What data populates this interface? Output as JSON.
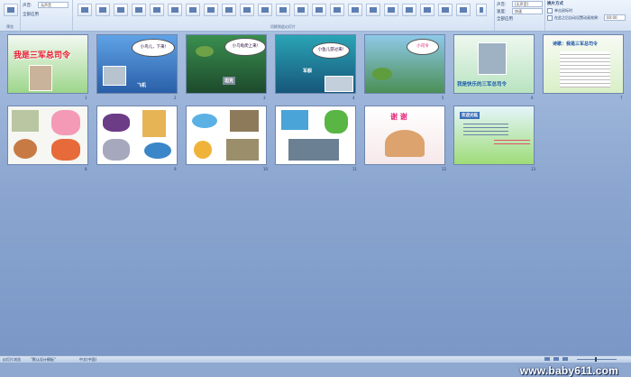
{
  "ribbon": {
    "left_group": {
      "btn_preview": "预览",
      "btn_apply": "应用",
      "label": "预览"
    },
    "sound_label": "声音:",
    "sound_value": "[无声音]",
    "speed_label": "速度:",
    "speed_value": "快速",
    "apply_all": "全部应用",
    "transition_group_label": "切换到此幻灯片",
    "advance_group_label": "换片方式",
    "on_click": "单击鼠标时",
    "auto_after": "在此之后自动设置动画效果:",
    "auto_time": "00:00",
    "field_sound": "无声音"
  },
  "slides": [
    {
      "num": "1",
      "title": "我是三军总司令"
    },
    {
      "num": "2",
      "bubble": "小鸟儿，下来!",
      "tag": "飞机"
    },
    {
      "num": "3",
      "bubble": "小乌龟爬上来!",
      "tag": "坦克"
    },
    {
      "num": "4",
      "bubble": "小鱼儿游过来!",
      "tag": "军舰"
    },
    {
      "num": "5",
      "bubble": "小司令"
    },
    {
      "num": "6",
      "title": "我是快乐的三军总司令"
    },
    {
      "num": "7",
      "title": "诗歌：我是三军总司令"
    },
    {
      "num": "8"
    },
    {
      "num": "9"
    },
    {
      "num": "10"
    },
    {
      "num": "11"
    },
    {
      "num": "12",
      "title": "谢 谢"
    },
    {
      "num": "13",
      "text": "欢迎光临"
    }
  ],
  "watermark": "www.baby611.com",
  "status": {
    "view": "幻灯片浏览",
    "theme": "\"默认设计模板\"",
    "lang": "中文(中国)"
  }
}
